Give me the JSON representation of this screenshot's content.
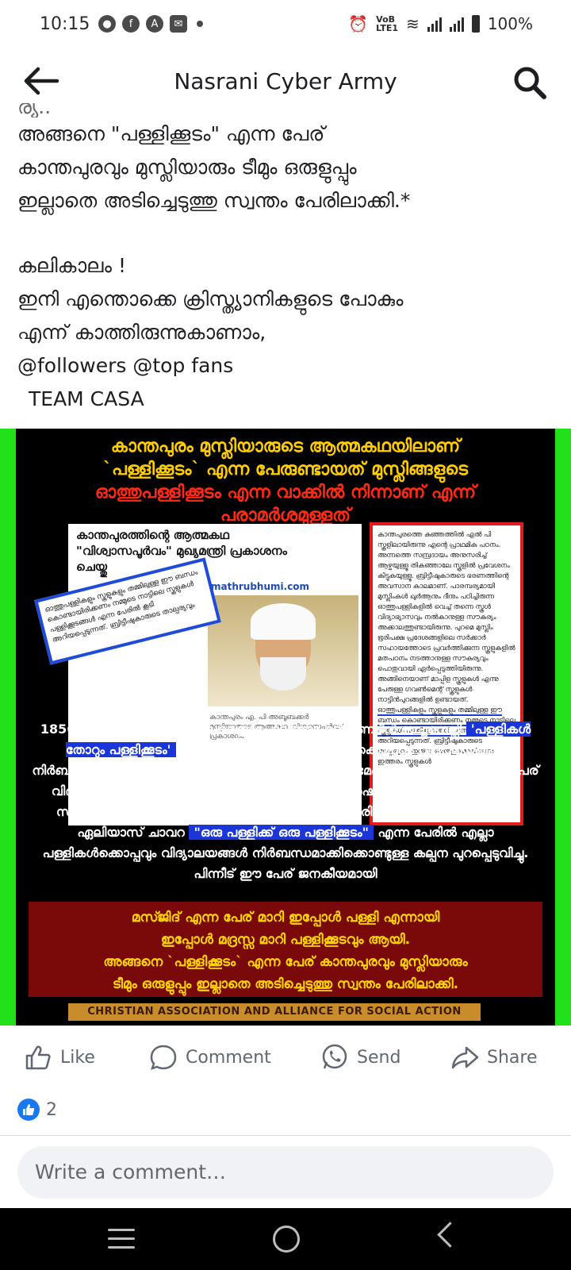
{
  "status_bar": {
    "time": "10:15",
    "battery": "100%",
    "network": "LTE1",
    "volte": "VoB"
  },
  "header": {
    "title": "Nasrani Cyber Army"
  },
  "post": {
    "clipped_line": "ര്യ..",
    "lines": [
      "അങ്ങനെ  \"പള്ളിക്കൂടം\" എന്ന പേര്",
      "കാന്തപുരവും മുസ്ലിയാരും ടീമും ഒരുളുപ്പും",
      "ഇല്ലാതെ അടിച്ചെടുത്തു സ്വന്തം പേരിലാക്കി.*"
    ],
    "lines2": [
      "കലികാലം !",
      "ഇനി എന്തൊക്കെ ക്രിസ്ത്യാനികളുടെ പോകും",
      "എന്ന് കാത്തിരുന്നുകാണാം,",
      "@followers  @top fans",
      "TEAM CASA"
    ]
  },
  "poster": {
    "headline_yellow_1": "കാന്തപുരം മുസ്ലിയാരുടെ ആത്മകഥയിലാണ്",
    "headline_yellow_2": "`പള്ളിക്കൂടം` എന്ന പേരുണ്ടായത് മുസ്ലിങ്ങളുടെ",
    "headline_red_1": "ഓത്തുപള്ളിക്കൂടം എന്ന വാക്കിൽ നിന്നാണ് എന്ന്",
    "headline_red_2": "പരാമർശമുള്ളത്",
    "clip_title_1": "കാന്തപുരത്തിന്റെ ആത്മകഥ",
    "clip_title_2": "\"വിശ്വാസപൂർവം\" മുഖ്യമന്ത്രി പ്രകാശനം",
    "clip_title_3": "ചെയ്തു",
    "clip_site": "mathrubhumi.com",
    "clip_caption": "കാന്തപുരം എ. പി അബൂബക്കർ മുസ്ലിയാരുടെ ആത്മകഥ 'വിശ്വാസപൂർവം' പ്രകാശനം",
    "callout_text": "ഓത്തുപള്ളികളും സ്കൂളുകളും തമ്മിലുള്ള ഈ ബന്ധം കൊണ്ടായിരിക്കണം നമ്മുടെ നാട്ടിലെ സ്കൂളുകൾ പള്ളിക്കൂടങ്ങൾ എന്ന പേരിൽ കൂടി അറിയപ്പെടുന്നത്. ബ്രിട്ടീഷുകാരുടെ താല്പര്യവും",
    "side_clip_text": "കാന്തപുരത്തെ കുഞ്ഞത്തിൽ എൽ പി സ്കൂളിലായിരുന്നു എന്റെ പ്രാഥമിക പഠനം. അന്നത്തെ സമ്പ്രദായം അനുസരിച്ച് ആഴ്ചയുള്ളൂ തികഞ്ഞാലേ സ്കൂളിൽ പ്രവേശനം കിട്ടുകയുള്ളൂ. ബ്രിട്ടീഷുകാരുടെ ഭരണത്തിന്റെ അവസാന കാലമാണ്. പാരമ്പര്യമായി മുസ്ലിംകൾ ഖുർആനും ദീനും പഠിച്ചിരുന്ന ഓത്തുപള്ളികളിൽ വെച്ച് തന്നെ സ്കൂൾ വിദ്യാഭ്യാസവും നൽകാനുള്ള സൗകര്യം അക്കാലത്തുണ്ടായിരുന്നു. പുറമെ മുസ്ലിം ഭൂരിപക്ഷ പ്രദേശങ്ങളിലെ സർക്കാർ സഹായത്തോടെ പ്രവർത്തിക്കുന്ന സ്കൂളുകളിൽ മതപഠനം നടത്താനുള്ള സൗകര്യവും പൊതുവായി ഏർപ്പെടുത്തിയിരുന്നു. അങ്ങിനെയാണ് മാപ്പിള സ്കൂളുകൾ എന്നു പേരുള്ള ഗവൺമെന്റ് സ്കൂളുകൾ നാട്ടിൻപുറങ്ങളിൽ ഉണ്ടായത്.",
    "side_clip_highlight": "ഓത്തുപള്ളികളും സ്കൂളുകളും തമ്മിലുള്ള ഈ ബന്ധം കൊണ്ടായിരിക്കണം നമ്മുടെ നാട്ടിലെ സ്കൂളുകൾ പള്ളിക്കൂടങ്ങൾ എന്ന പേരിൽ കൂടി",
    "side_clip_end": "അറിയപ്പെടുന്നത്. ബ്രിട്ടീഷുകാരുടെ താല്പര്യവും ഇതിനു അനുകൂലമായിരുന്നു ഇത്തരം സ്കൂളുകൾ",
    "body_1": "1856ൽ വരാപ്പുഴ അതിരൂപത മെത്രാപ്പോലീത്താ ബെർണദീൻ ബച്ചനെല്ലി",
    "body_hl_1": "'പള്ളികൾ തോറും പള്ളിക്കൂടം'",
    "body_2": "എന്ന പേരിൽ എല്ലാ പള്ളികൾക്കൊപ്പവും വിദ്യാലയങ്ങൾ നിർബന്ധമാക്കിക്കൊണ്ടുള്ള കല്പന പുറപ്പെടുവിച്ചു. കാലക്രമേണ പള്ളിക്കൂടങ്ങൾ എന്നപേര് വിദ്യാലയങ്ങളുടെ പര്യായമായി പരിണമിച്ചു.അതിനുശേഷം 1864ൽ കേരളത്തിലെ സുറിയാനി കത്തോലിക്കരുടെ വികാരി ജനറൽ ആയിരിക്കവേ മാർ കുര്യാക്കോസ് ഏലിയാസ് ചാവറ",
    "body_hl_2": "\"ഒരു പള്ളിക്ക് ഒരു പള്ളിക്കൂടം\"",
    "body_3": "എന്ന പേരിൽ എല്ലാ പള്ളികൾക്കൊപ്പവും വിദ്യാലയങ്ങൾ നിർബന്ധമാക്കിക്കൊണ്ടുള്ള കല്പന പുറപ്പെടുവിച്ചു. പിന്നീട് ഈ പേര് ജനകീയമായി",
    "box_1": "മസ്ജിദ് എന്ന പേര് മാറി ഇപ്പോൾ പള്ളി എന്നായി",
    "box_2": "ഇപ്പോൾ മദ്രസ്സ മാറി പള്ളിക്കൂടവും ആയി.",
    "box_3": "അങ്ങനെ `പള്ളിക്കൂടം` എന്ന പേര് കാന്തപുരവും മുസ്ലിയാരും",
    "box_4": "ടീമും ഒരുളുപ്പും ഇല്ലാതെ അടിച്ചെടുത്തു സ്വന്തം പേരിലാക്കി.",
    "banner": "CHRISTIAN ASSOCIATION AND ALLIANCE FOR SOCIAL ACTION"
  },
  "actions": {
    "like": "Like",
    "comment": "Comment",
    "send": "Send",
    "share": "Share"
  },
  "reactions": {
    "count": "2"
  },
  "comment_input": {
    "placeholder": "Write a comment…"
  },
  "colors": {
    "poster_green": "#22e01a",
    "highlight_blue": "#1a35d8",
    "headline_yellow": "#ffcc00",
    "headline_red": "#ff2a14",
    "like_blue": "#1877f2"
  }
}
